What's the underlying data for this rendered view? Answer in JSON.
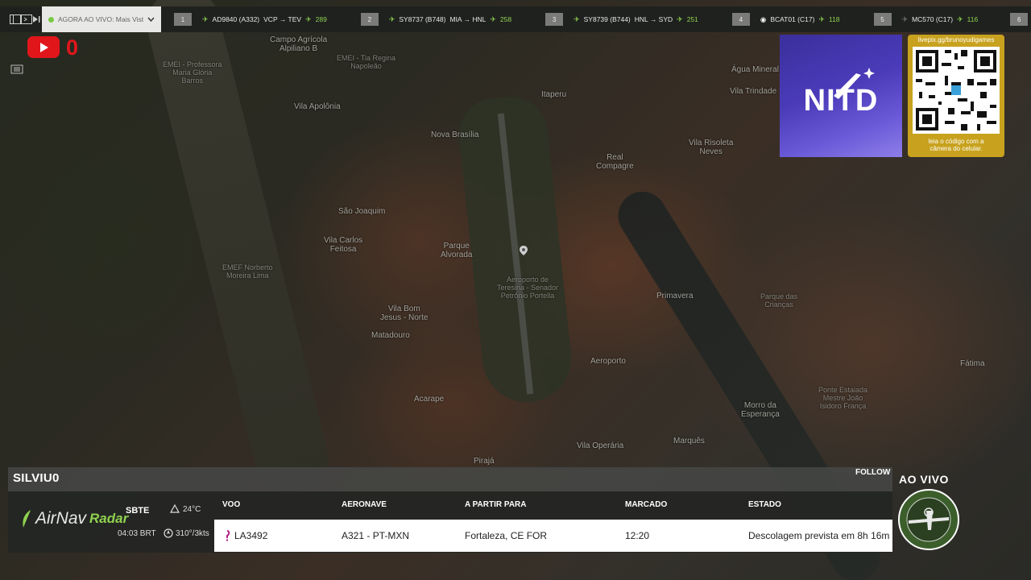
{
  "topbar": {
    "live_label": "AGORA AO VIVO: Mais Vistos",
    "flights": [
      {
        "rank": "1",
        "callsign": "AD9840 (A332)",
        "route": "VCP → TEV",
        "count": "289"
      },
      {
        "rank": "2",
        "callsign": "SY8737 (B748)",
        "route": "MIA → HNL",
        "count": "258"
      },
      {
        "rank": "3",
        "callsign": "SY8739 (B744)",
        "route": "HNL → SYD",
        "count": "251"
      },
      {
        "rank": "4",
        "callsign": "BCAT01 (C17)",
        "route": "",
        "count": "118"
      },
      {
        "rank": "5",
        "callsign": "MC570 (C17)",
        "route": "",
        "count": "116"
      },
      {
        "rank": "6",
        "callsign": "",
        "route": "",
        "count": ""
      }
    ]
  },
  "youtube": {
    "count": "0"
  },
  "map_labels": [
    {
      "text": "Campo Agrícola\nAlpiliano B"
    },
    {
      "text": "EMEI - Professora\nMaria Glória\nBarros"
    },
    {
      "text": "EMEI - Tia Regina\nNapoleão"
    },
    {
      "text": "Vila Apolônia"
    },
    {
      "text": "Itaperu"
    },
    {
      "text": "Nova Brasília"
    },
    {
      "text": "São Joaquim"
    },
    {
      "text": "Vila Carlos\nFeitosa"
    },
    {
      "text": "Parque\nAlvorada"
    },
    {
      "text": "Aeroporto de\nTeresina - Senador\nPetrônio Portella"
    },
    {
      "text": "Real\nCompagre"
    },
    {
      "text": "Vila Risoleta\nNeves"
    },
    {
      "text": "Primavera"
    },
    {
      "text": "Vila Bom\nJesus - Norte"
    },
    {
      "text": "Matadouro"
    },
    {
      "text": "Aeroporto"
    },
    {
      "text": "Acarape"
    },
    {
      "text": "Morro da\nEsperança"
    },
    {
      "text": "Vila Operária"
    },
    {
      "text": "Marquês"
    },
    {
      "text": "Pirajá"
    },
    {
      "text": "EMEF Norberto\nMoreira Lima"
    },
    {
      "text": "Vila Trindade"
    },
    {
      "text": "Água Mineral"
    },
    {
      "text": "Parque das\nCrianças"
    },
    {
      "text": "Fátima"
    },
    {
      "text": "Ponte Estaiada\nMestre João\nIsidoro França"
    }
  ],
  "promo": {
    "logo_text": "NITD",
    "qr_url": "livepix.gg/brunoyudigames",
    "qr_caption": "leia o código com a\ncâmera do celular."
  },
  "panel": {
    "callsign": "SILVIU0",
    "follow": "FOLLOW",
    "brand_main": "AirNav",
    "brand_sub": "Radar",
    "airport": "SBTE",
    "local_time": "04:03 BRT",
    "temperature": "24°C",
    "wind": "310°/3kts",
    "headers": {
      "flight": "VOO",
      "aircraft": "AERONAVE",
      "from_to": "A PARTIR PARA",
      "scheduled": "MARCADO",
      "status": "ESTADO"
    },
    "row": {
      "flight": "LA3492",
      "aircraft": "A321 - PT-MXN",
      "from_to": "Fortaleza, CE FOR",
      "scheduled": "12:20",
      "status": "Descolagem prevista em 8h 16m"
    }
  },
  "live_badge": "AO VIVO",
  "colors": {
    "accent_green": "#8fd14f",
    "youtube_red": "#e1161b",
    "qr_gold": "#c8a21e",
    "promo_purple": "#4b3bb9"
  }
}
